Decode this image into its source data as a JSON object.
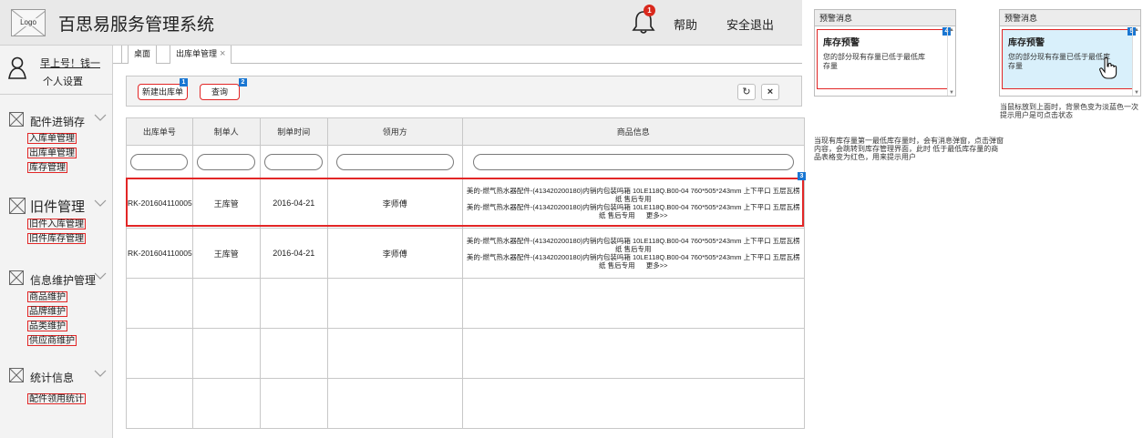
{
  "header": {
    "logo_text": "Logo",
    "app_title": "百思易服务管理系统",
    "notification_count": "1",
    "help_label": "帮助",
    "logout_label": "安全退出"
  },
  "user": {
    "greeting": "早上号！钱一",
    "settings_label": "个人设置"
  },
  "sidebar": {
    "groups": [
      {
        "label": "配件进销存",
        "items": [
          "入库单管理",
          "出库单管理",
          "库存管理"
        ]
      },
      {
        "label": "旧件管理",
        "items": [
          "旧件入库管理",
          "旧件库存管理"
        ]
      },
      {
        "label": "信息维护管理",
        "items": [
          "商品维护",
          "品牌维护",
          "品类维护",
          "供应商维护"
        ]
      },
      {
        "label": "统计信息",
        "items": [
          "配件领用统计"
        ]
      }
    ]
  },
  "tabs": [
    {
      "label": "桌面"
    },
    {
      "label": "出库单管理",
      "close": "×"
    }
  ],
  "toolbar": {
    "new_label": "新建出库单",
    "new_marker": "1",
    "query_label": "查询",
    "query_marker": "2",
    "refresh_icon": "refresh-icon",
    "close_icon": "close-icon",
    "close_glyph": "×",
    "refresh_glyph": "↻"
  },
  "table": {
    "headers": [
      "出库单号",
      "制单人",
      "制单时间",
      "领用方",
      "商品信息"
    ],
    "row_marker": "3",
    "rows": [
      {
        "order_no": "RK-201604110005",
        "maker": "王库管",
        "date": "2016-04-21",
        "recipient": "李师傅",
        "goods_line1": "美的-燃气热水器配件-(413420200180)内销内包装吗箱 10LE118Q.B00-04 760*505*243mm 上下平口 五层瓦楞纸 售后专用",
        "goods_line2": "美的-燃气热水器配件-(413420200180)内销内包装吗箱 10LE118Q.B00-04 760*505*243mm 上下平口 五层瓦楞纸 售后专用",
        "more": "更多>>"
      },
      {
        "order_no": "RK-201604110005",
        "maker": "王库管",
        "date": "2016-04-21",
        "recipient": "李师傅",
        "goods_line1": "美的-燃气热水器配件-(413420200180)内销内包装吗箱 10LE118Q.B00-04 760*505*243mm 上下平口 五层瓦楞纸 售后专用",
        "goods_line2": "美的-燃气热水器配件-(413420200180)内销内包装吗箱 10LE118Q.B00-04 760*505*243mm 上下平口 五层瓦楞纸 售后专用",
        "more": "更多>>"
      }
    ]
  },
  "popups": [
    {
      "title": "预警消息",
      "marker": "4",
      "heading": "库存预警",
      "text": "您的部分现有存量已低于最低库存量"
    },
    {
      "title": "预警消息",
      "marker": "5",
      "heading": "库存预警",
      "text": "您的部分现有存量已低于最低库存量"
    }
  ],
  "notes": {
    "hover_note": "当鼠标放到上面时，背景色变为淡蓝色一次提示用户是可点击状态",
    "alert_note": "当现有库存量第一最低库存量时，会有消息弹窗，点击弹窗内容，会跳转到库存管理界面，此时 低于最低库存量的商品表格变为红色，用来提示用户"
  },
  "colors": {
    "accent_red": "#e22626",
    "marker_blue": "#1976d2",
    "hover_blue": "#d9f0fb",
    "badge_red": "#d9281c"
  }
}
